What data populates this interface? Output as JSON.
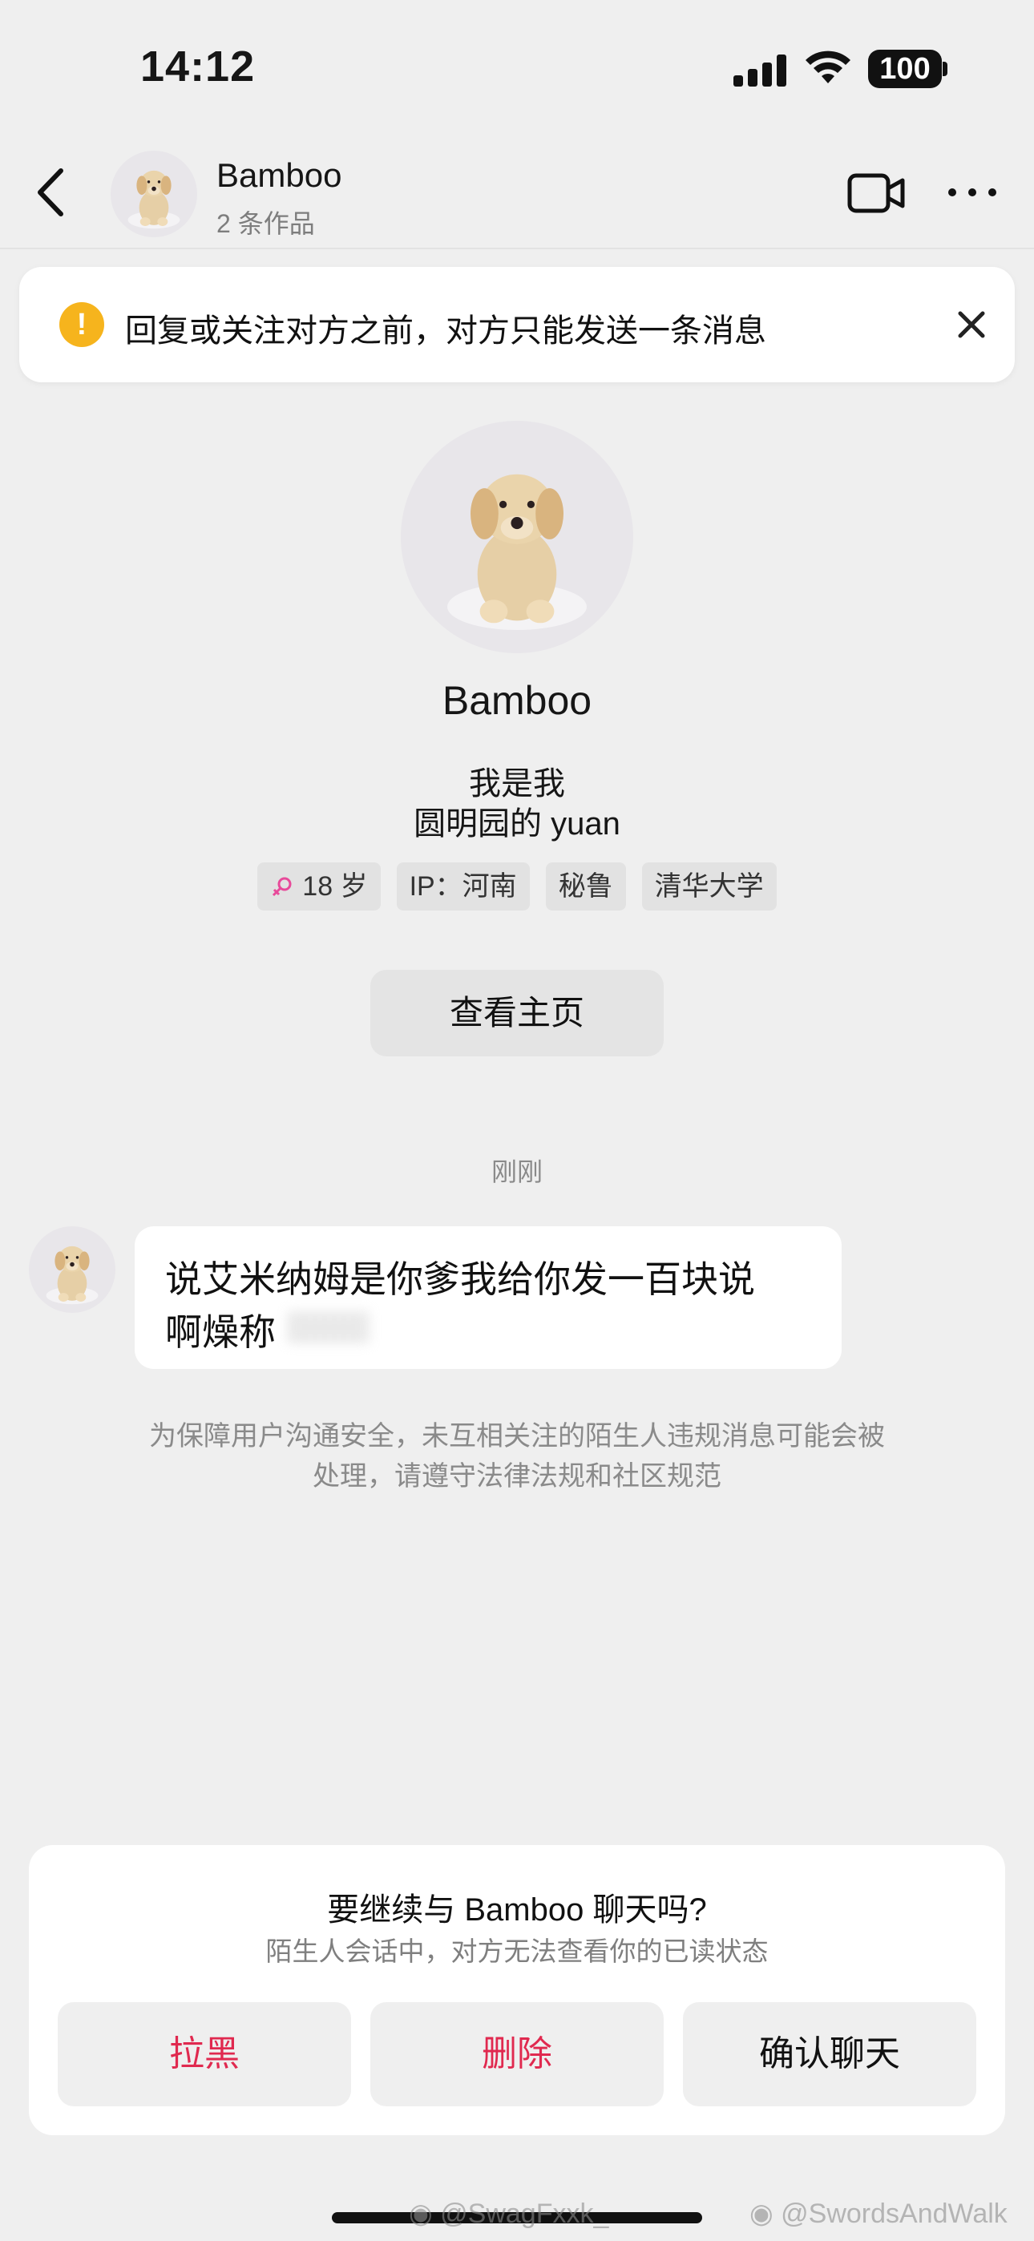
{
  "status_bar": {
    "time": "14:12",
    "battery": "100"
  },
  "header": {
    "name": "Bamboo",
    "subtitle": "2 条作品"
  },
  "notice": {
    "text": "回复或关注对方之前，对方只能发送一条消息"
  },
  "profile": {
    "name": "Bamboo",
    "bio_line1": "我是我",
    "bio_line2": "圆明园的 yuan",
    "tags": [
      "18 岁",
      "IP：河南",
      "秘鲁",
      "清华大学"
    ],
    "view_home_label": "查看主页"
  },
  "chat": {
    "timestamp": "刚刚",
    "message_line1": "说艾米纳姆是你爹我给你发一百块说",
    "message_line2": "啊燥称",
    "safety_line1": "为保障用户沟通安全，未互相关注的陌生人违规消息可能会被",
    "safety_line2": "处理，请遵守法律法规和社区规范"
  },
  "sheet": {
    "title": "要继续与 Bamboo 聊天吗?",
    "subtitle": "陌生人会话中，对方无法查看你的已读状态",
    "block_label": "拉黑",
    "delete_label": "删除",
    "confirm_label": "确认聊天"
  },
  "watermarks": [
    "@SwagFxxk_",
    "@SwordsAndWalk"
  ],
  "colors": {
    "accent_red": "#e0294f",
    "warning_yellow": "#f6b41d",
    "gender_pink": "#e84a9a"
  },
  "icons": [
    "back-arrow-icon",
    "video-call-icon",
    "more-icon",
    "warning-icon",
    "close-icon",
    "female-icon",
    "weibo-icon"
  ]
}
